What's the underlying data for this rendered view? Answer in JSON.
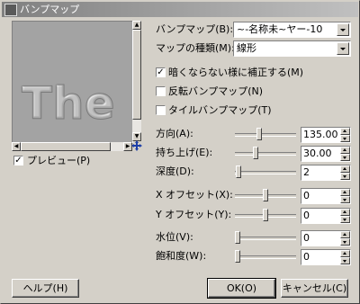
{
  "window": {
    "title": "バンプマップ"
  },
  "preview": {
    "watermark": "The",
    "checkbox_label": "プレビュー(P)",
    "checked": true
  },
  "bump_map": {
    "label": "バンプマップ(B):",
    "value": "~-名称未~ヤー-10"
  },
  "map_type": {
    "label": "マップの種類(M):",
    "value": "線形"
  },
  "options": [
    {
      "label": "暗くならない様に補正する(M)",
      "checked": true
    },
    {
      "label": "反転バンプマップ(N)",
      "checked": false
    },
    {
      "label": "タイルバンプマップ(T)",
      "checked": false
    }
  ],
  "params": [
    {
      "label": "方向(A):",
      "value": "135.00",
      "level": 0.38
    },
    {
      "label": "持ち上げ(E):",
      "value": "30.00",
      "level": 0.33
    },
    {
      "label": "深度(D):",
      "value": "2",
      "level": 0.02
    },
    {
      "label": "X オフセット(X):",
      "value": "0",
      "level": 0.5
    },
    {
      "label": "Y オフセット(Y):",
      "value": "0",
      "level": 0.5
    },
    {
      "label": "水位(V):",
      "value": "0",
      "level": 0.0
    },
    {
      "label": "飽和度(W):",
      "value": "0",
      "level": 0.0
    }
  ],
  "buttons": {
    "help": "ヘルプ(H)",
    "ok": "OK(O)",
    "cancel": "キャンセル(C)"
  },
  "icons": {
    "move": "move-cross-icon",
    "checkmark": "✓"
  }
}
